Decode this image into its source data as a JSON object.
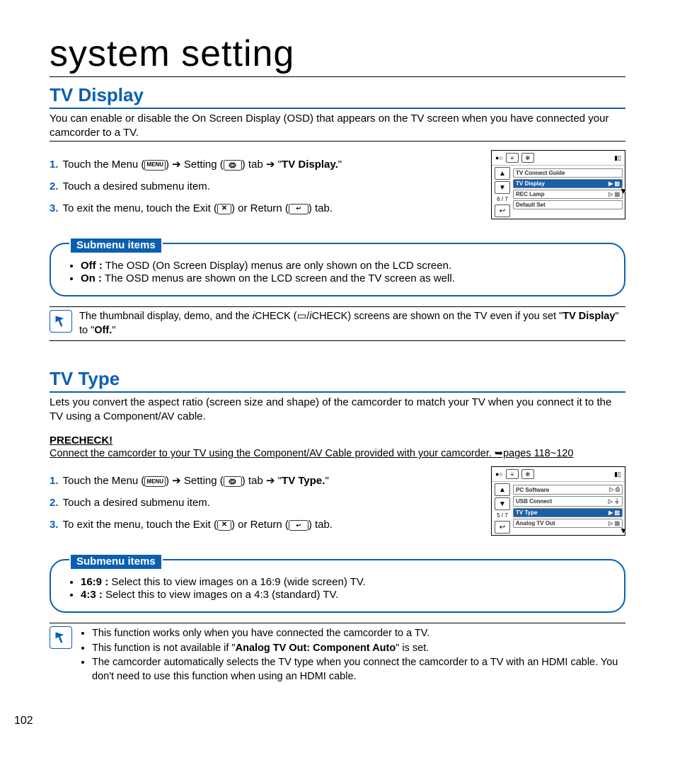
{
  "page_number": "102",
  "main_title": "system setting",
  "section1": {
    "heading": "TV Display",
    "intro": "You can enable or disable the On Screen Display (OSD) that appears on the TV screen when you have connected your camcorder to a TV.",
    "steps": {
      "s1_a": "Touch the Menu (",
      "s1_b": ") ",
      "s1_arrow": "➔",
      "s1_c": " Setting (",
      "s1_d": ") tab ",
      "s1_e": " \"",
      "s1_target": "TV Display.",
      "s1_f": "\"",
      "s2": "Touch a desired submenu item.",
      "s3_a": "To exit the menu, touch the Exit (",
      "s3_b": ") or Return (",
      "s3_c": ") tab."
    },
    "lcd": {
      "page": "6 / 7",
      "rows": [
        "TV Connect Guide",
        "TV Display",
        "REC Lamp",
        "Default Set"
      ],
      "active_row": 1
    },
    "submenu_label": "Submenu items",
    "sub_off_k": "Off :",
    "sub_off_v": " The OSD (On Screen Display) menus are only shown on the LCD screen.",
    "sub_on_k": "On :",
    "sub_on_v": " The OSD menus are shown on the LCD screen and the TV screen as well.",
    "note_a": "The thumbnail display, demo, and the ",
    "note_b": "CHECK (",
    "note_c": "/",
    "note_d": "CHECK) screens are shown on the TV even if you set \"",
    "note_e": "TV Display",
    "note_f": "\" to \"",
    "note_g": "Off.",
    "note_h": "\""
  },
  "section2": {
    "heading": "TV Type",
    "intro": "Lets you convert the aspect ratio (screen size and shape) of the camcorder to match your TV when you connect it to the TV using a Component/AV cable.",
    "precheck_h": "PRECHECK!",
    "precheck_t": "Connect the camcorder to your TV using the Component/AV Cable provided with your camcorder. ➥pages 118~120",
    "steps": {
      "s1_a": "Touch the Menu (",
      "s1_b": ") ",
      "s1_arrow": "➔",
      "s1_c": " Setting (",
      "s1_d": ") tab ",
      "s1_e": " \"",
      "s1_target": "TV Type.",
      "s1_f": "\"",
      "s2": "Touch a desired submenu item.",
      "s3_a": "To exit the menu, touch the Exit (",
      "s3_b": ") or Return (",
      "s3_c": ") tab."
    },
    "lcd": {
      "page": "5 / 7",
      "rows": [
        "PC Software",
        "USB Connect",
        "TV Type",
        "Analog TV Out"
      ],
      "active_row": 2
    },
    "submenu_label": "Submenu items",
    "sub_169_k": "16:9 :",
    "sub_169_v": " Select this to view images on a 16:9 (wide screen) TV.",
    "sub_43_k": "4:3 :",
    "sub_43_v": " Select this to view images on a 4:3 (standard) TV.",
    "notes": {
      "n1": "This function works only when you have connected the camcorder to a TV.",
      "n2_a": "This function is not available if \"",
      "n2_b": "Analog TV Out: Component Auto",
      "n2_c": "\" is set.",
      "n3": "The camcorder automatically selects the TV type when you connect the camcorder to a TV with an HDMI cable. You don't need to use this function when using an HDMI cable."
    }
  },
  "icons": {
    "menu": "MENU",
    "x": "✕",
    "ret": "↩",
    "up": "▲",
    "down": "▼"
  }
}
